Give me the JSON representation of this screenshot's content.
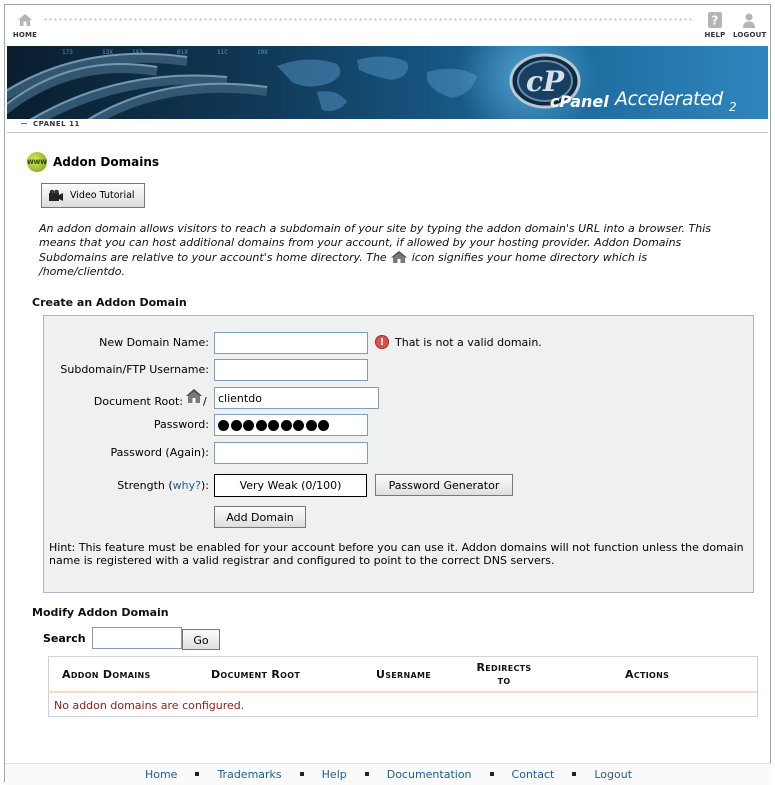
{
  "topnav": {
    "home_label": "HOME",
    "help_label": "HELP",
    "logout_label": "LOGOUT"
  },
  "banner": {
    "brand": "cPanel",
    "accelerated": "Accelerated",
    "version_sub": "2"
  },
  "tab": {
    "label": "CPANEL 11"
  },
  "page": {
    "title": "Addon Domains",
    "icon": "www-globe-icon",
    "video_tutorial_label": "Video Tutorial",
    "intro_part1": "An addon domain allows visitors to reach a subdomain of your site by typing the addon domain's URL into a browser. This means that you can host additional domains from your account, if allowed by your hosting provider. Addon Domains Subdomains are relative to your account's home directory. The",
    "intro_part2": "icon signifies your home directory which is",
    "intro_path": "/home/clientdo."
  },
  "create": {
    "section_title": "Create an Addon Domain",
    "new_domain_label": "New Domain Name:",
    "new_domain_value": "",
    "new_domain_error": "That is not a valid domain.",
    "subdomain_label": "Subdomain/FTP Username:",
    "subdomain_value": "",
    "docroot_label": "Document Root:",
    "docroot_prefix": "/",
    "docroot_value": "clientdo",
    "password_label": "Password:",
    "password_dots": 9,
    "password_again_label": "Password (Again):",
    "password_again_value": "",
    "strength_label_pre": "Strength (",
    "strength_link": "why?",
    "strength_label_post": "):",
    "strength_value": "Very Weak (0/100)",
    "password_generator_label": "Password Generator",
    "add_domain_label": "Add Domain",
    "hint": "Hint: This feature must be enabled for your account before you can use it. Addon domains will not function unless the domain name is registered with a valid registrar and configured to point to the correct DNS servers."
  },
  "modify": {
    "section_title": "Modify Addon Domain",
    "search_label": "Search",
    "search_value": "",
    "go_label": "Go",
    "columns": [
      "Addon Domains",
      "Document Root",
      "Username",
      "Redirects to",
      "Actions"
    ],
    "empty_message": "No addon domains are configured."
  },
  "footer": {
    "links": [
      "Home",
      "Trademarks",
      "Help",
      "Documentation",
      "Contact",
      "Logout"
    ]
  }
}
